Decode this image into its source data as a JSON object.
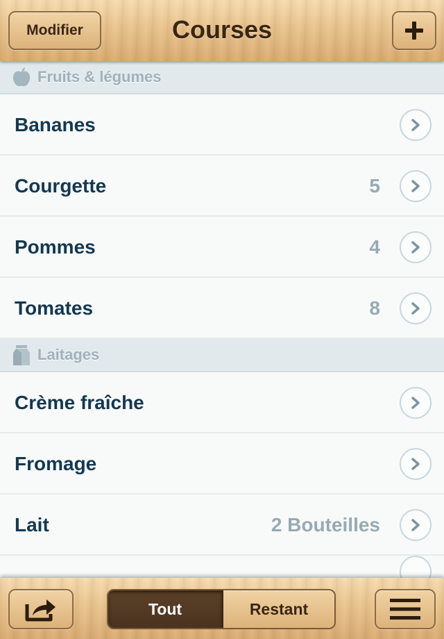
{
  "header": {
    "edit_label": "Modifier",
    "title": "Courses",
    "add_icon": "plus-icon"
  },
  "sections": [
    {
      "label": "Fruits & légumes",
      "icon": "apple-icon",
      "items": [
        {
          "name": "Bananes",
          "qty": ""
        },
        {
          "name": "Courgette",
          "qty": "5"
        },
        {
          "name": "Pommes",
          "qty": "4"
        },
        {
          "name": "Tomates",
          "qty": "8"
        }
      ]
    },
    {
      "label": "Laitages",
      "icon": "milk-carton-icon",
      "items": [
        {
          "name": "Crème fraîche",
          "qty": ""
        },
        {
          "name": "Fromage",
          "qty": ""
        },
        {
          "name": "Lait",
          "qty": "2 Bouteilles"
        }
      ]
    }
  ],
  "footer": {
    "share_icon": "share-icon",
    "segments": {
      "all": "Tout",
      "remaining": "Restant"
    },
    "selected_segment": "all",
    "menu_icon": "menu-icon"
  },
  "colors": {
    "item_text": "#143851",
    "qty_text": "#97aab4",
    "section_bg": "#e2e9ec",
    "header_text": "#3a2614"
  }
}
